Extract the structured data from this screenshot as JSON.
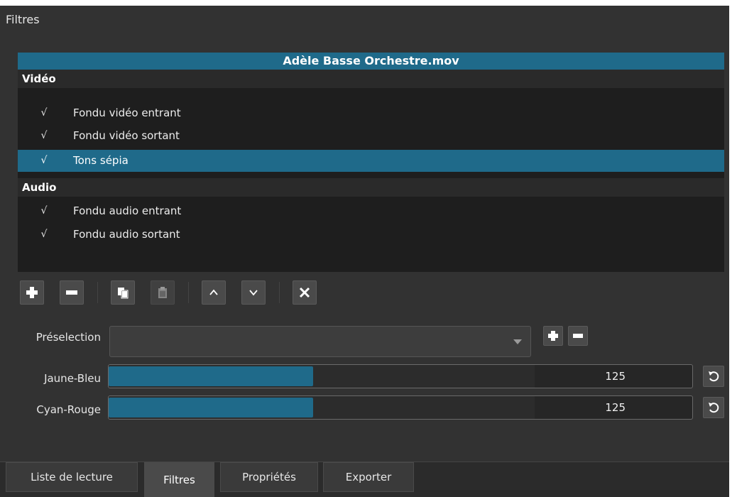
{
  "panel": {
    "title": "Filtres"
  },
  "clip": {
    "name": "Adèle Basse Orchestre.mov"
  },
  "filters": {
    "video_header": "Vidéo",
    "video": [
      {
        "check": "√",
        "name": "Fondu vidéo entrant"
      },
      {
        "check": "√",
        "name": "Fondu vidéo sortant"
      },
      {
        "check": "√",
        "name": "Tons sépia",
        "selected": true
      }
    ],
    "audio_header": "Audio",
    "audio": [
      {
        "check": "√",
        "name": "Fondu audio entrant"
      },
      {
        "check": "√",
        "name": "Fondu audio sortant"
      }
    ]
  },
  "toolbar": {
    "icons": [
      "add-icon",
      "remove-icon",
      "copy-icon",
      "paste-icon",
      "move-up-icon",
      "move-down-icon",
      "clear-icon"
    ]
  },
  "preset": {
    "label": "Préselection",
    "value": ""
  },
  "params": [
    {
      "label": "Jaune-Bleu",
      "value": "125",
      "fraction": 0.35
    },
    {
      "label": "Cyan-Rouge",
      "value": "125",
      "fraction": 0.35
    }
  ],
  "tabs": [
    {
      "label": "Liste de lecture",
      "active": false
    },
    {
      "label": "Filtres",
      "active": true
    },
    {
      "label": "Propriétés",
      "active": false
    },
    {
      "label": "Exporter",
      "active": false
    }
  ],
  "colors": {
    "accent": "#1f6a8a",
    "panel_bg": "#323232",
    "list_bg": "#1e1e1e"
  }
}
